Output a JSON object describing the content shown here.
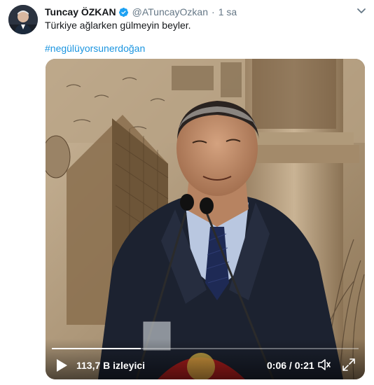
{
  "tweet": {
    "author_name": "Tuncay ÖZKAN",
    "handle": "@ATuncayOzkan",
    "separator": "·",
    "time": "1 sa",
    "text": "Türkiye ağlarken gülmeyin beyler.",
    "hashtag": "#negülüyorsunerdoğan"
  },
  "video": {
    "views": "113,7 B izleyici",
    "time_display": "0:06 / 0:21",
    "progress": 0.29
  },
  "icons": {
    "verified": "verified-badge-icon",
    "menu": "chevron-down-icon",
    "play": "play-icon",
    "volume": "volume-icon",
    "fullscreen": "fullscreen-icon"
  },
  "colors": {
    "link": "#1b95e0",
    "verified": "#1da1f2",
    "text": "#14171a",
    "secondary": "#657786"
  }
}
